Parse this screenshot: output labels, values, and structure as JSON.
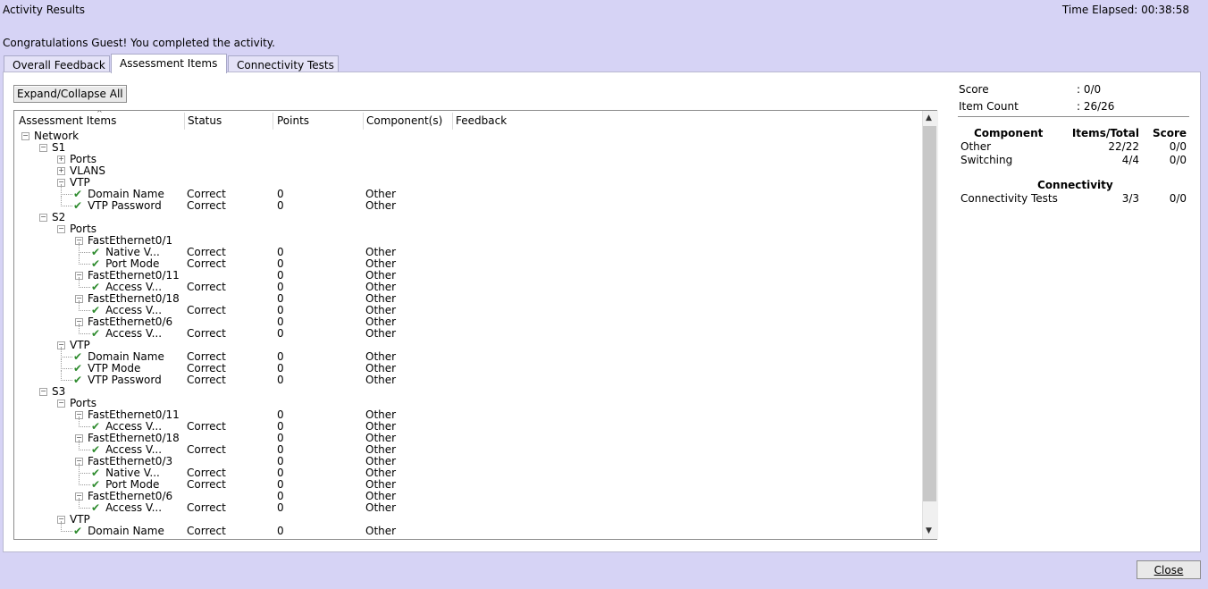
{
  "window": {
    "title": "Activity Results",
    "time_elapsed": "Time Elapsed: 00:38:58"
  },
  "message": "Congratulations Guest! You completed the activity.",
  "tabs": [
    {
      "label": "Overall Feedback"
    },
    {
      "label": "Assessment Items"
    },
    {
      "label": "Connectivity Tests"
    }
  ],
  "active_tab": "Assessment Items",
  "expand_button": "Expand/Collapse All",
  "columns": [
    "Assessment Items",
    "Status",
    "Points",
    "Component(s)",
    "Feedback"
  ],
  "tree": [
    {
      "label": "Network",
      "level": 0,
      "toggle": "minus"
    },
    {
      "label": "S1",
      "level": 1,
      "toggle": "minus"
    },
    {
      "label": "Ports",
      "level": 2,
      "toggle": "plus"
    },
    {
      "label": "VLANS",
      "level": 2,
      "toggle": "plus"
    },
    {
      "label": "VTP",
      "level": 2,
      "toggle": "minus"
    },
    {
      "label": "Domain Name",
      "level": 3,
      "check": true,
      "status": "Correct",
      "points": "0",
      "component": "Other"
    },
    {
      "label": "VTP Password",
      "level": 3,
      "check": true,
      "status": "Correct",
      "points": "0",
      "component": "Other"
    },
    {
      "label": "S2",
      "level": 1,
      "toggle": "minus"
    },
    {
      "label": "Ports",
      "level": 2,
      "toggle": "minus"
    },
    {
      "label": "FastEthernet0/1",
      "level": 3,
      "toggle": "minus"
    },
    {
      "label": "Native V...",
      "level": 4,
      "check": true,
      "status": "Correct",
      "points": "0",
      "component": "Other"
    },
    {
      "label": "Port Mode",
      "level": 4,
      "check": true,
      "status": "Correct",
      "points": "0",
      "component": "Other"
    },
    {
      "label": "FastEthernet0/11",
      "level": 3,
      "toggle": "minus",
      "points": "0",
      "component": "Other"
    },
    {
      "label": "Access V...",
      "level": 4,
      "check": true,
      "status": "Correct",
      "points": "0",
      "component": "Other"
    },
    {
      "label": "FastEthernet0/18",
      "level": 3,
      "toggle": "minus",
      "points": "0",
      "component": "Other"
    },
    {
      "label": "Access V...",
      "level": 4,
      "check": true,
      "status": "Correct",
      "points": "0",
      "component": "Other"
    },
    {
      "label": "FastEthernet0/6",
      "level": 3,
      "toggle": "minus",
      "points": "0",
      "component": "Other"
    },
    {
      "label": "Access V...",
      "level": 4,
      "check": true,
      "status": "Correct",
      "points": "0",
      "component": "Other"
    },
    {
      "label": "VTP",
      "level": 2,
      "toggle": "minus"
    },
    {
      "label": "Domain Name",
      "level": 3,
      "check": true,
      "status": "Correct",
      "points": "0",
      "component": "Other"
    },
    {
      "label": "VTP Mode",
      "level": 3,
      "check": true,
      "status": "Correct",
      "points": "0",
      "component": "Other"
    },
    {
      "label": "VTP Password",
      "level": 3,
      "check": true,
      "status": "Correct",
      "points": "0",
      "component": "Other"
    },
    {
      "label": "S3",
      "level": 1,
      "toggle": "minus"
    },
    {
      "label": "Ports",
      "level": 2,
      "toggle": "minus"
    },
    {
      "label": "FastEthernet0/11",
      "level": 3,
      "toggle": "minus",
      "points": "0",
      "component": "Other"
    },
    {
      "label": "Access V...",
      "level": 4,
      "check": true,
      "status": "Correct",
      "points": "0",
      "component": "Other"
    },
    {
      "label": "FastEthernet0/18",
      "level": 3,
      "toggle": "minus",
      "points": "0",
      "component": "Other"
    },
    {
      "label": "Access V...",
      "level": 4,
      "check": true,
      "status": "Correct",
      "points": "0",
      "component": "Other"
    },
    {
      "label": "FastEthernet0/3",
      "level": 3,
      "toggle": "minus",
      "points": "0",
      "component": "Other"
    },
    {
      "label": "Native V...",
      "level": 4,
      "check": true,
      "status": "Correct",
      "points": "0",
      "component": "Other"
    },
    {
      "label": "Port Mode",
      "level": 4,
      "check": true,
      "status": "Correct",
      "points": "0",
      "component": "Other"
    },
    {
      "label": "FastEthernet0/6",
      "level": 3,
      "toggle": "minus",
      "points": "0",
      "component": "Other"
    },
    {
      "label": "Access V...",
      "level": 4,
      "check": true,
      "status": "Correct",
      "points": "0",
      "component": "Other"
    },
    {
      "label": "VTP",
      "level": 2,
      "toggle": "minus"
    },
    {
      "label": "Domain Name",
      "level": 3,
      "check": true,
      "status": "Correct",
      "points": "0",
      "component": "Other"
    }
  ],
  "summary": {
    "score_label": "Score",
    "score_value": ": 0/0",
    "count_label": "Item Count",
    "count_value": ": 26/26",
    "component_header": "Component",
    "items_header": "Items/Total",
    "score_header": "Score",
    "components": [
      {
        "name": "Other",
        "items": "22/22",
        "score": "0/0"
      },
      {
        "name": "Switching",
        "items": "4/4",
        "score": "0/0"
      }
    ],
    "connectivity_header": "Connectivity",
    "connectivity": {
      "name": "Connectivity Tests",
      "items": "3/3",
      "score": "0/0"
    }
  },
  "close_button": "Close",
  "colors": {
    "background": "#d6d3f5",
    "check": "#2e8b2e"
  },
  "icons": [
    "check-icon",
    "expand-plus-icon",
    "collapse-minus-icon",
    "scroll-up-icon",
    "scroll-down-icon"
  ]
}
